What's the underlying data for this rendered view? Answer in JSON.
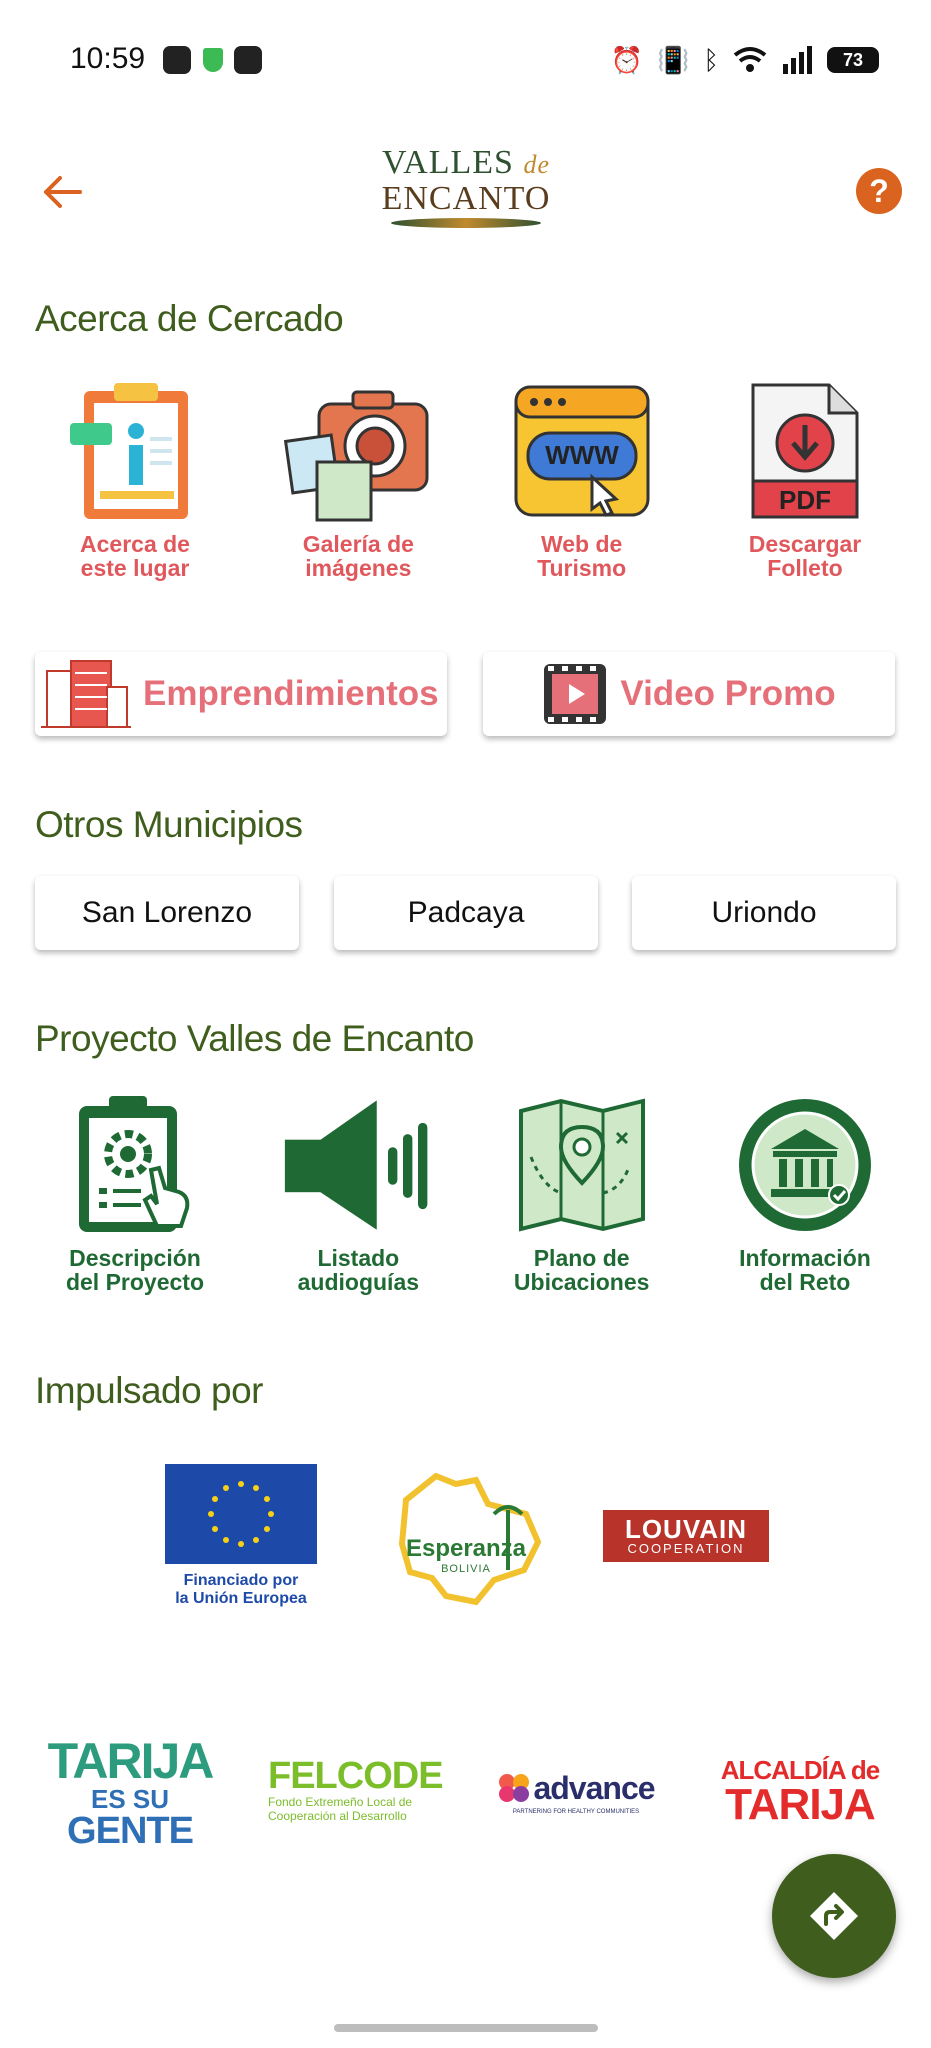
{
  "status": {
    "time": "10:59",
    "battery": "73"
  },
  "header": {
    "logo_line1": "VALLES",
    "logo_de": "de",
    "logo_line2": "ENCANTO",
    "help_label": "?"
  },
  "about": {
    "title": "Acerca de Cercado",
    "items": [
      {
        "label": "Acerca de\neste lugar",
        "icon": "clipboard-info-icon"
      },
      {
        "label": "Galería de\nimágenes",
        "icon": "camera-photos-icon"
      },
      {
        "label": "Web de\nTurismo",
        "icon": "www-browser-icon"
      },
      {
        "label": "Descargar\nFolleto",
        "icon": "pdf-download-icon"
      }
    ]
  },
  "buttons": {
    "entrepreneurship": "Emprendimientos",
    "video": "Video Promo"
  },
  "municipalities": {
    "title": "Otros Municipios",
    "items": [
      "San Lorenzo",
      "Padcaya",
      "Uriondo"
    ]
  },
  "project": {
    "title": "Proyecto Valles de Encanto",
    "items": [
      {
        "label": "Descripción\ndel Proyecto",
        "icon": "clipboard-gear-icon"
      },
      {
        "label": "Listado\naudioguías",
        "icon": "speaker-icon"
      },
      {
        "label": "Plano de\nUbicaciones",
        "icon": "map-pin-icon"
      },
      {
        "label": "Información\ndel Reto",
        "icon": "museum-badge-icon"
      }
    ]
  },
  "sponsors": {
    "title": "Impulsado por",
    "eu_caption": "Financiado por\nla Unión Europea",
    "esperanza": "Esperanza",
    "esperanza_sub": "BOLIVIA",
    "louvain": "LOUVAIN",
    "louvain_sub": "COOPERATION",
    "tarija_1": "TARIJA",
    "tarija_2": "ES SU",
    "tarija_3": "GENTE",
    "felcode": "FELCODE",
    "felcode_sub": "Fondo Extremeño Local de\nCooperación al Desarrollo",
    "advance": "advance",
    "advance_sub": "PARTNERING FOR HEALTHY COMMUNITIES",
    "alcaldia_1": "ALCALDÍA de",
    "alcaldia_2": "TARIJA"
  },
  "colors": {
    "accent_orange": "#d9631f",
    "section_green": "#3f5e1e",
    "label_red": "#e0585c",
    "label_green": "#1f6a34",
    "button_pink": "#e6707a"
  }
}
